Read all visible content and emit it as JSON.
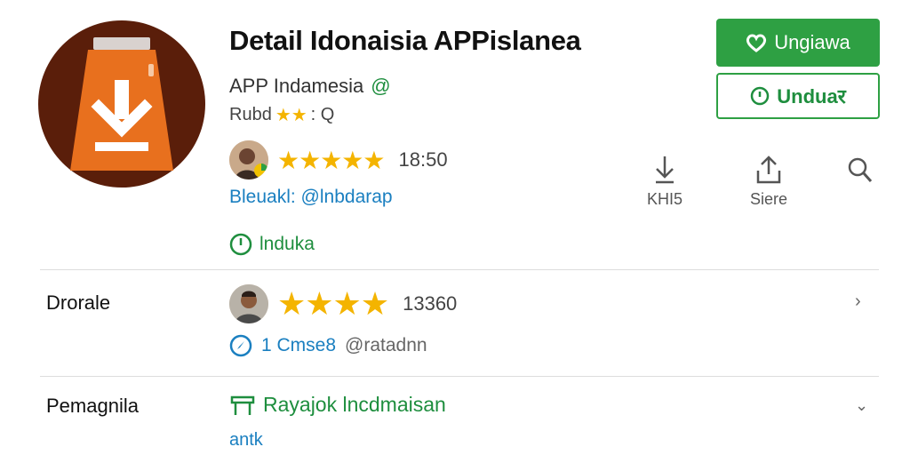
{
  "app": {
    "title": "Detail Idonaisia APPislanea",
    "developer": "APP Indamesia",
    "verified_icon": "@",
    "rating_prefix": "Rubd",
    "rating_suffix": ": Q"
  },
  "buttons": {
    "primary_label": "Ungiawa",
    "secondary_label": "Unduaर"
  },
  "top_review": {
    "count": "18:50",
    "stars": 4.5,
    "link": "Bleuakl: @lnbdarap",
    "status": "lnduka"
  },
  "actions": [
    {
      "label": "KHI5",
      "icon": "download-icon"
    },
    {
      "label": "Siere",
      "icon": "share-icon"
    },
    {
      "label": "",
      "icon": "search-icon"
    }
  ],
  "sections": [
    {
      "label": "Drorale",
      "count": "13360",
      "stars": 4.5,
      "meta_a": "1 Cmse8",
      "meta_b": "@ratadnn"
    },
    {
      "label": "Pemagnila",
      "line1": "Rayajok lncdmaisan",
      "line2": "antk"
    }
  ],
  "colors": {
    "accent_green": "#2ea043",
    "link_blue": "#1a7fc0",
    "star": "#f4b400",
    "icon_bg": "#5a1e0a",
    "icon_orange": "#e8701e"
  }
}
